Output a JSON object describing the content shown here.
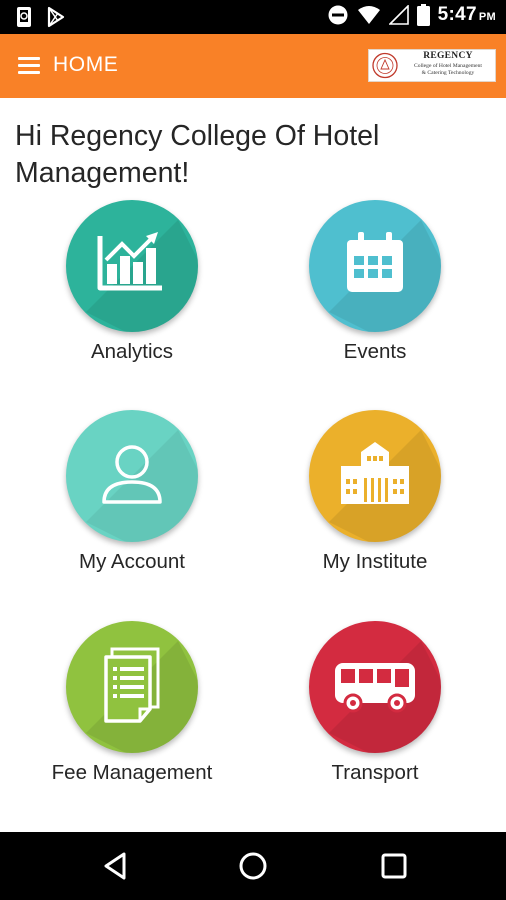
{
  "status_bar": {
    "time": "5:47",
    "ampm": "PM"
  },
  "app_bar": {
    "title": "HOME",
    "logo": {
      "name": "REGENCY",
      "line1": "College of Hotel Management",
      "line2": "& Catering Technology"
    }
  },
  "greeting": "Hi  Regency College Of Hotel Management!",
  "tiles": [
    {
      "label": "Analytics",
      "icon": "analytics-chart-icon",
      "color": "#2db39b"
    },
    {
      "label": "Events",
      "icon": "calendar-icon",
      "color": "#4fbfcf"
    },
    {
      "label": "My Account",
      "icon": "user-icon",
      "color": "#69d3c3"
    },
    {
      "label": "My Institute",
      "icon": "building-icon",
      "color": "#ebb02b"
    },
    {
      "label": "Fee Management",
      "icon": "documents-icon",
      "color": "#90c23f"
    },
    {
      "label": "Transport",
      "icon": "bus-icon",
      "color": "#d32b40"
    }
  ],
  "colors": {
    "app_bar": "#f98127",
    "background": "#ffffff",
    "text": "#262626"
  }
}
